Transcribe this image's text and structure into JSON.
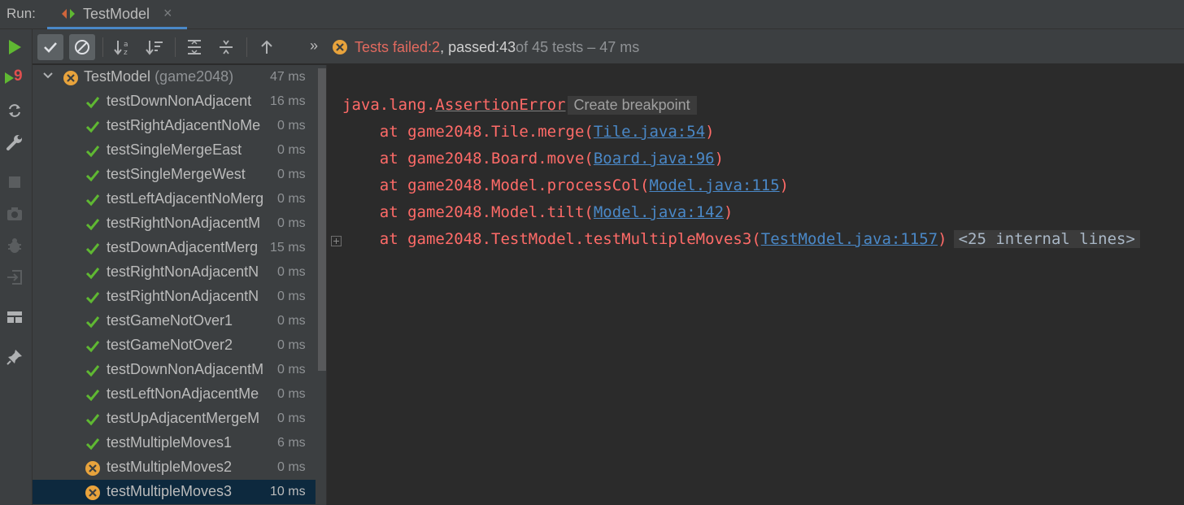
{
  "header": {
    "run_label": "Run:",
    "tab_title": "TestModel",
    "close_glyph": "×"
  },
  "left_toolbar": {
    "rerun_badge": "9",
    "icons": [
      "run-icon",
      "rerun-failed-icon",
      "toggle-auto-test-icon",
      "settings-wrench-icon",
      "stop-icon",
      "screenshot-icon",
      "debug-icon",
      "import-icon",
      "layout-icon",
      "pin-icon"
    ]
  },
  "toolbar": {
    "buttons": [
      "show-passed-icon",
      "show-ignored-icon",
      "sort-alpha-icon",
      "sort-duration-icon",
      "expand-all-icon",
      "collapse-all-icon",
      "previous-failed-icon"
    ],
    "chevron": "»",
    "status": {
      "failed_label": "Tests failed: ",
      "failed_count": "2",
      "passed_label": ", passed: ",
      "passed_count": "43",
      "of_label": " of 45 tests – 47 ms"
    }
  },
  "tree": {
    "root": {
      "name": "TestModel",
      "package": "(game2048)",
      "time": "47 ms",
      "status": "failed"
    },
    "tests": [
      {
        "name": "testDownNonAdjacent",
        "time": "16 ms",
        "status": "passed"
      },
      {
        "name": "testRightAdjacentNoMe",
        "time": "0 ms",
        "status": "passed"
      },
      {
        "name": "testSingleMergeEast",
        "time": "0 ms",
        "status": "passed"
      },
      {
        "name": "testSingleMergeWest",
        "time": "0 ms",
        "status": "passed"
      },
      {
        "name": "testLeftAdjacentNoMerg",
        "time": "0 ms",
        "status": "passed"
      },
      {
        "name": "testRightNonAdjacentM",
        "time": "0 ms",
        "status": "passed"
      },
      {
        "name": "testDownAdjacentMerg",
        "time": "15 ms",
        "status": "passed"
      },
      {
        "name": "testRightNonAdjacentN",
        "time": "0 ms",
        "status": "passed"
      },
      {
        "name": "testRightNonAdjacentN",
        "time": "0 ms",
        "status": "passed"
      },
      {
        "name": "testGameNotOver1",
        "time": "0 ms",
        "status": "passed"
      },
      {
        "name": "testGameNotOver2",
        "time": "0 ms",
        "status": "passed"
      },
      {
        "name": "testDownNonAdjacentM",
        "time": "0 ms",
        "status": "passed"
      },
      {
        "name": "testLeftNonAdjacentMe",
        "time": "0 ms",
        "status": "passed"
      },
      {
        "name": "testUpAdjacentMergeM",
        "time": "0 ms",
        "status": "passed"
      },
      {
        "name": "testMultipleMoves1",
        "time": "6 ms",
        "status": "passed"
      },
      {
        "name": "testMultipleMoves2",
        "time": "0 ms",
        "status": "failed"
      },
      {
        "name": "testMultipleMoves3",
        "time": "10 ms",
        "status": "failed",
        "selected": true
      }
    ]
  },
  "console": {
    "exception_pkg": "java.lang.",
    "exception_class": "AssertionError",
    "breakpoint_hint": "Create breakpoint",
    "frames": [
      {
        "prefix": "    at game2048.Tile.merge(",
        "link": "Tile.java:54",
        "suffix": ")"
      },
      {
        "prefix": "    at game2048.Board.move(",
        "link": "Board.java:96",
        "suffix": ")"
      },
      {
        "prefix": "    at game2048.Model.processCol(",
        "link": "Model.java:115",
        "suffix": ")"
      },
      {
        "prefix": "    at game2048.Model.tilt(",
        "link": "Model.java:142",
        "suffix": ")"
      },
      {
        "prefix": "    at game2048.TestModel.testMultipleMoves3(",
        "link": "TestModel.java:1157",
        "suffix": ")"
      }
    ],
    "internal_lines": "<25 internal lines>"
  },
  "colors": {
    "passed": "#5fb832",
    "failed": "#e8a33c",
    "error_text": "#ff6b68",
    "link": "#4a88c7",
    "accent": "#4a88c7"
  }
}
